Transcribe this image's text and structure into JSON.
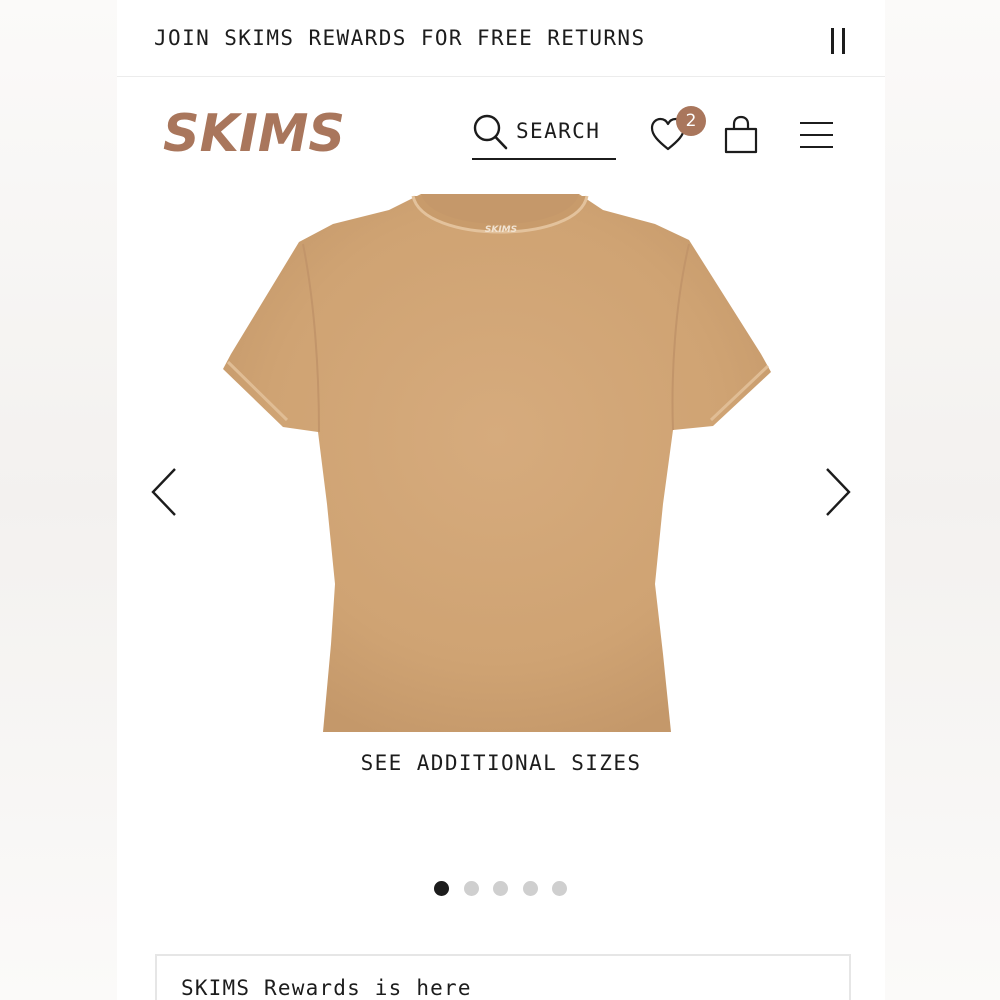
{
  "announcement": {
    "text": "JOIN SKIMS REWARDS FOR FREE RETURNS",
    "pause_icon": "pause-icon"
  },
  "header": {
    "logo_text": "SKIMS",
    "logo_color": "#a9765c",
    "search_label": "SEARCH",
    "search_icon": "search-icon",
    "wishlist_icon": "heart-icon",
    "wishlist_count": "2",
    "badge_color": "#a9765c",
    "bag_icon": "shopping-bag-icon",
    "menu_icon": "hamburger-menu-icon"
  },
  "carousel": {
    "product_color": "#d0a577",
    "image_label": "SKIMS",
    "prev_icon": "chevron-left-icon",
    "next_icon": "chevron-right-icon",
    "sizes_link": "SEE ADDITIONAL SIZES",
    "slide_count": 5,
    "active_slide": 1
  },
  "rewards": {
    "title": "SKIMS Rewards is here"
  }
}
